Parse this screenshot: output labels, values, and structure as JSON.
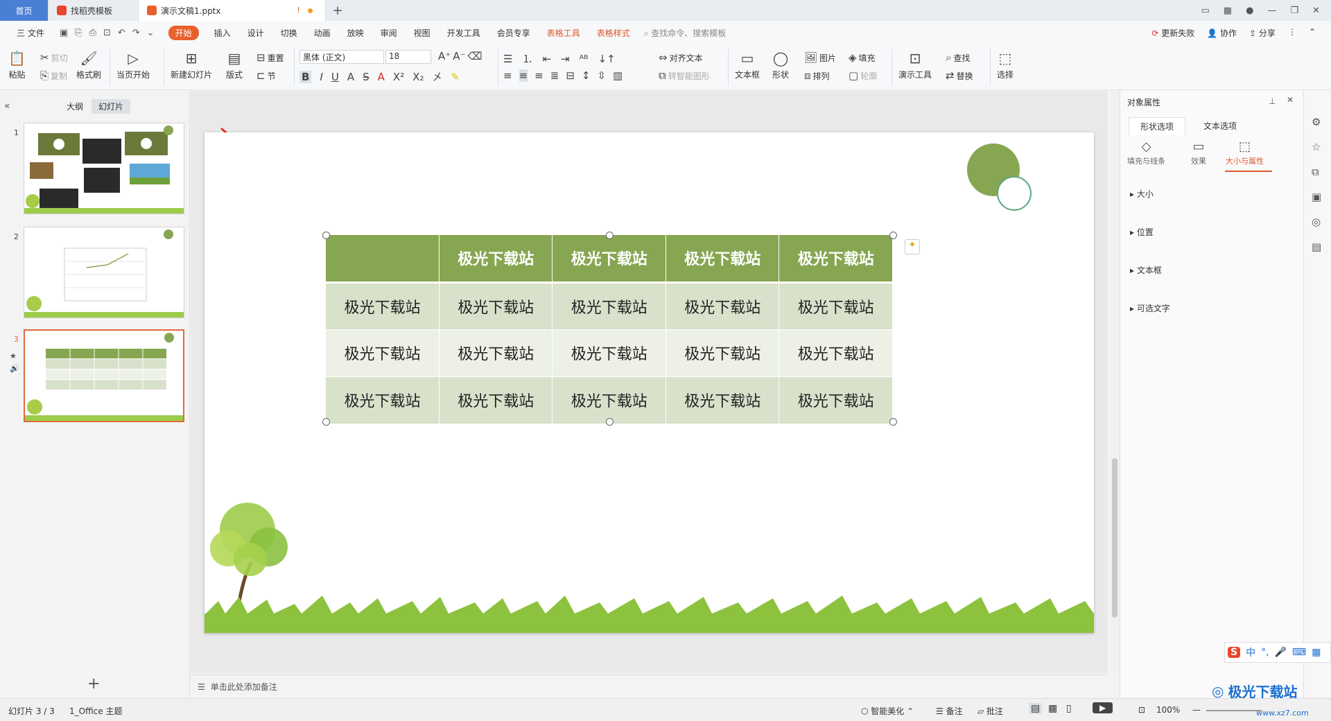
{
  "titlebar": {
    "tabs": [
      {
        "label": "首页"
      },
      {
        "label": "找稻壳模板"
      },
      {
        "label": "演示文稿1.pptx"
      }
    ],
    "new_tab": "+",
    "warn": "!"
  },
  "menubar": {
    "file": "三 文件",
    "items": [
      "开始",
      "插入",
      "设计",
      "切换",
      "动画",
      "放映",
      "审阅",
      "视图",
      "开发工具",
      "会员专享"
    ],
    "context_items": [
      "表格工具",
      "表格样式"
    ],
    "search": "查找命令、搜索模板",
    "right": [
      "更新失败",
      "协作",
      "分享"
    ]
  },
  "ribbon": {
    "paste": "粘贴",
    "cut": "剪切",
    "copy": "复制",
    "format_painter": "格式刷",
    "from_current": "当页开始",
    "new_slide": "新建幻灯片",
    "layout": "版式",
    "reset": "重置",
    "section": "节",
    "font_name": "黑体 (正文)",
    "font_size": "18",
    "align_text": "对齐文本",
    "convert_smartart": "转智能图形",
    "textbox": "文本框",
    "shape": "形状",
    "picture": "图片",
    "fill": "填充",
    "arrange": "排列",
    "outline": "轮廓",
    "present_tool": "演示工具",
    "find": "查找",
    "replace": "替换",
    "select": "选择"
  },
  "left_panel": {
    "tab_outline": "大纲",
    "tab_slides": "幻灯片",
    "slide_numbers": [
      "1",
      "2",
      "3"
    ]
  },
  "table": {
    "header": [
      "",
      "极光下载站",
      "极光下载站",
      "极光下载站",
      "极光下载站"
    ],
    "rows": [
      [
        "极光下载站",
        "极光下载站",
        "极光下载站",
        "极光下载站",
        "极光下载站"
      ],
      [
        "极光下载站",
        "极光下载站",
        "极光下载站",
        "极光下载站",
        "极光下载站"
      ],
      [
        "极光下载站",
        "极光下载站",
        "极光下载站",
        "极光下载站",
        "极光下载站"
      ]
    ]
  },
  "notes": {
    "placeholder": "单击此处添加备注"
  },
  "right_panel": {
    "title": "对象属性",
    "tab_shape": "形状选项",
    "tab_text": "文本选项",
    "sub_fill": "填充与线条",
    "sub_effect": "效果",
    "sub_size": "大小与属性",
    "sections": [
      "大小",
      "位置",
      "文本框",
      "可选文字"
    ]
  },
  "statusbar": {
    "slide_info": "幻灯片 3 / 3",
    "theme": "1_Office 主题",
    "smart_beautify": "智能美化",
    "notes": "备注",
    "comments": "批注",
    "zoom": "100%"
  },
  "ime": {
    "label": "中"
  },
  "watermark": {
    "text": "极光下载站",
    "url": "www.xz7.com"
  },
  "colors": {
    "accent": "#e8612c",
    "table_header": "#87a652",
    "table_row_a": "#d8e1ca",
    "table_row_b": "#ecf0e5",
    "selection": "#e06a3b"
  }
}
